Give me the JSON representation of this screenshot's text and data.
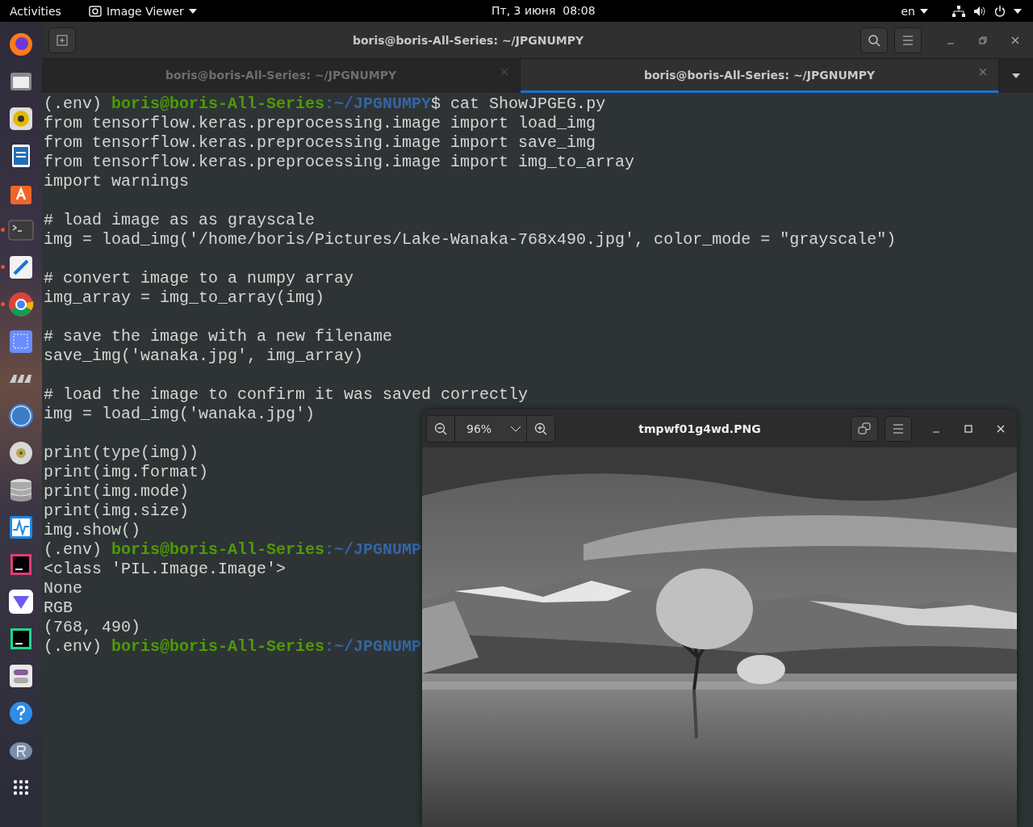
{
  "top_bar": {
    "activities": "Activities",
    "app_menu": "Image Viewer",
    "clock": "Пт, 3 июня  08:08",
    "language": "en"
  },
  "dock": [
    {
      "running": false
    },
    {
      "running": false
    },
    {
      "running": false
    },
    {
      "running": false
    },
    {
      "running": false
    },
    {
      "running": true
    },
    {
      "running": true
    },
    {
      "running": true
    },
    {
      "running": false
    },
    {
      "running": false
    },
    {
      "running": false
    },
    {
      "running": false
    },
    {
      "running": false
    },
    {
      "running": false
    },
    {
      "running": false
    },
    {
      "running": false
    },
    {
      "running": false
    },
    {
      "running": false
    },
    {
      "running": false
    },
    {
      "running": false
    }
  ],
  "terminal": {
    "title": "boris@boris-All-Series: ~/JPGNUMPY",
    "tabs": [
      {
        "label": "boris@boris-All-Series: ~/JPGNUMPY",
        "selected": false
      },
      {
        "label": "boris@boris-All-Series: ~/JPGNUMPY",
        "selected": true
      }
    ],
    "lines": [
      {
        "kind": "prompt",
        "env": "(.env) ",
        "user": "boris@boris-All-Series",
        "path": ":~/JPGNUMPY",
        "command": "$ cat ShowJPGEG.py"
      },
      {
        "kind": "text",
        "text": "from tensorflow.keras.preprocessing.image import load_img"
      },
      {
        "kind": "text",
        "text": "from tensorflow.keras.preprocessing.image import save_img"
      },
      {
        "kind": "text",
        "text": "from tensorflow.keras.preprocessing.image import img_to_array"
      },
      {
        "kind": "text",
        "text": "import warnings"
      },
      {
        "kind": "blank"
      },
      {
        "kind": "text",
        "text": "# load image as as grayscale"
      },
      {
        "kind": "text",
        "text": "img = load_img('/home/boris/Pictures/Lake-Wanaka-768x490.jpg', color_mode = \"grayscale\")"
      },
      {
        "kind": "blank"
      },
      {
        "kind": "text",
        "text": "# convert image to a numpy array"
      },
      {
        "kind": "text",
        "text": "img_array = img_to_array(img)"
      },
      {
        "kind": "blank"
      },
      {
        "kind": "text",
        "text": "# save the image with a new filename"
      },
      {
        "kind": "text",
        "text": "save_img('wanaka.jpg', img_array)"
      },
      {
        "kind": "blank"
      },
      {
        "kind": "text",
        "text": "# load the image to confirm it was saved correctly"
      },
      {
        "kind": "text",
        "text": "img = load_img('wanaka.jpg')"
      },
      {
        "kind": "blank"
      },
      {
        "kind": "text",
        "text": "print(type(img))"
      },
      {
        "kind": "text",
        "text": "print(img.format)"
      },
      {
        "kind": "text",
        "text": "print(img.mode)"
      },
      {
        "kind": "text",
        "text": "print(img.size)"
      },
      {
        "kind": "text",
        "text": "img.show()"
      },
      {
        "kind": "prompt",
        "env": "(.env) ",
        "user": "boris@boris-All-Series",
        "path": ":~/JPGNUMP"
      },
      {
        "kind": "text",
        "text": "<class 'PIL.Image.Image'>"
      },
      {
        "kind": "text",
        "text": "None"
      },
      {
        "kind": "text",
        "text": "RGB"
      },
      {
        "kind": "text",
        "text": "(768, 490)"
      },
      {
        "kind": "prompt",
        "env": "(.env) ",
        "user": "boris@boris-All-Series",
        "path": ":~/JPGNUMP"
      }
    ]
  },
  "image_viewer": {
    "zoom": "96%",
    "title": "tmpwf01g4wd.PNG"
  }
}
